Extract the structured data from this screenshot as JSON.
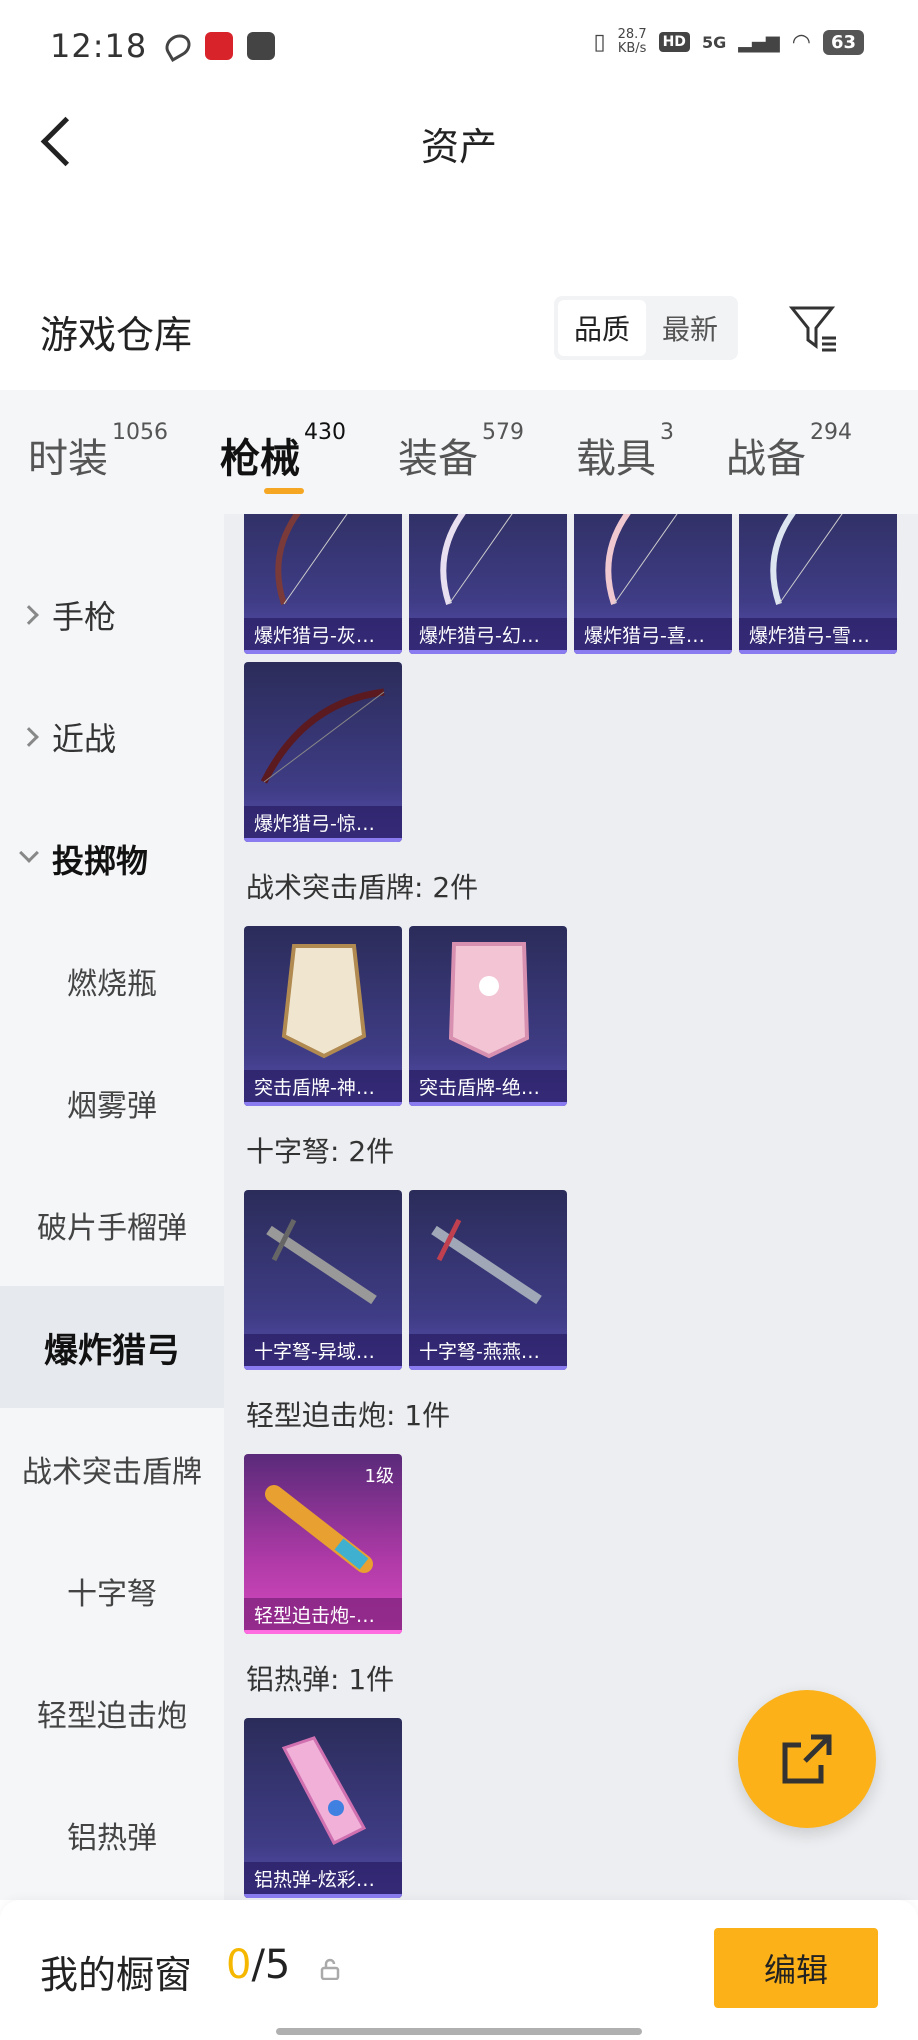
{
  "status_bar": {
    "time": "12:18",
    "speed_value": "28.7",
    "speed_unit": "KB/s",
    "hd": "HD",
    "network": "5G",
    "battery": "63"
  },
  "header": {
    "title": "资产"
  },
  "warehouse": {
    "title": "游戏仓库",
    "sort_options": [
      "品质",
      "最新"
    ],
    "active_sort": "品质"
  },
  "tabs": [
    {
      "label": "时装",
      "count": "1056"
    },
    {
      "label": "枪械",
      "count": "430",
      "active": true
    },
    {
      "label": "装备",
      "count": "579"
    },
    {
      "label": "载具",
      "count": "3"
    },
    {
      "label": "战备",
      "count": "294"
    }
  ],
  "sidebar": {
    "items": [
      {
        "label": "手枪",
        "type": "group",
        "expanded": false
      },
      {
        "label": "近战",
        "type": "group",
        "expanded": false
      },
      {
        "label": "投掷物",
        "type": "group",
        "expanded": true
      },
      {
        "label": "燃烧瓶",
        "type": "sub"
      },
      {
        "label": "烟雾弹",
        "type": "sub"
      },
      {
        "label": "破片手榴弹",
        "type": "sub"
      },
      {
        "label": "爆炸猎弓",
        "type": "sub",
        "active": true
      },
      {
        "label": "战术突击盾牌",
        "type": "sub"
      },
      {
        "label": "十字弩",
        "type": "sub"
      },
      {
        "label": "轻型迫击炮",
        "type": "sub"
      },
      {
        "label": "铝热弹",
        "type": "sub"
      }
    ]
  },
  "sections": {
    "bows": {
      "items": [
        "爆炸猎弓-灰…",
        "爆炸猎弓-幻…",
        "爆炸猎弓-喜…",
        "爆炸猎弓-雪…",
        "爆炸猎弓-惊…"
      ]
    },
    "shields": {
      "title": "战术突击盾牌: 2件",
      "items": [
        "突击盾牌-神…",
        "突击盾牌-绝…"
      ]
    },
    "crossbows": {
      "title": "十字弩: 2件",
      "items": [
        "十字弩-异域…",
        "十字弩-燕燕…"
      ]
    },
    "mortar": {
      "title": "轻型迫击炮: 1件",
      "items": [
        "轻型迫击炮-…"
      ],
      "level": "1级"
    },
    "thermite": {
      "title": "铝热弹: 1件",
      "items": [
        "铝热弹-炫彩…"
      ]
    }
  },
  "bottom_bar": {
    "label": "我的橱窗",
    "current": "0",
    "total": "/5",
    "edit": "编辑"
  },
  "colors": {
    "accent": "#fbb117",
    "card_purple": "#3f3c85",
    "card_pink": "#b03aa8"
  }
}
